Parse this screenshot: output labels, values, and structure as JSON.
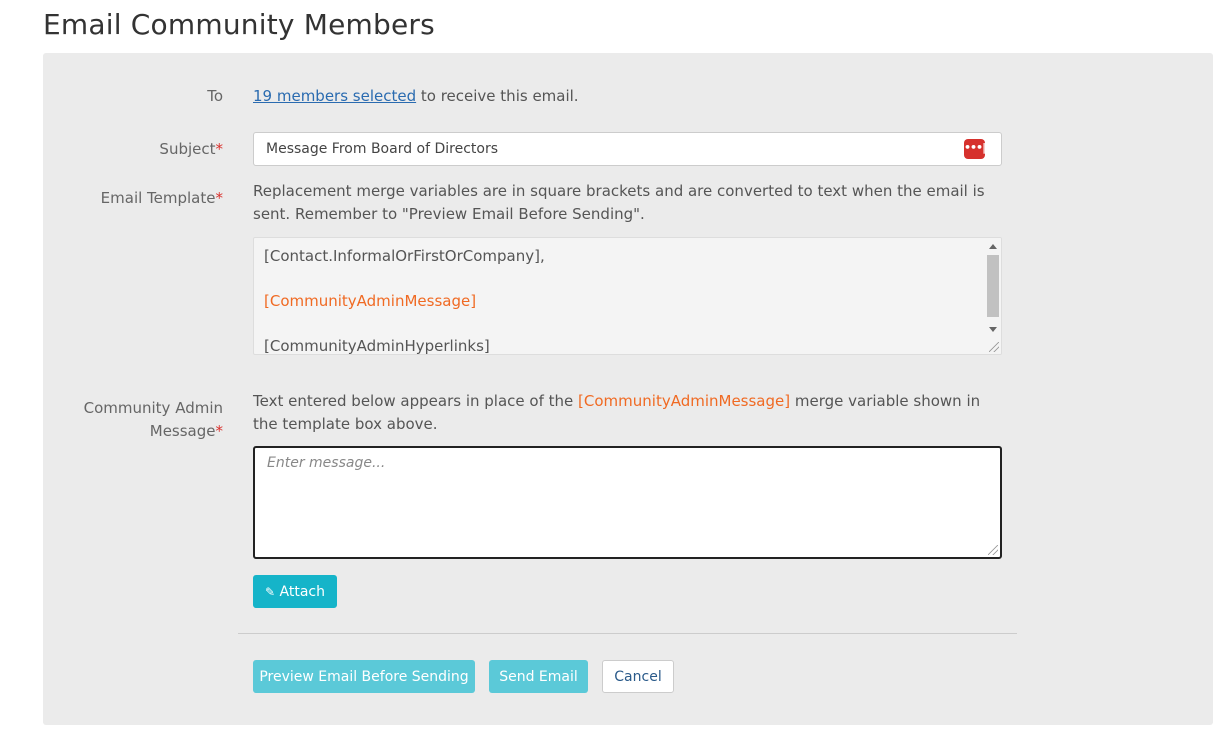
{
  "page": {
    "title": "Email Community Members"
  },
  "form": {
    "to": {
      "label": "To",
      "link_text": "19 members selected",
      "suffix": " to receive this email."
    },
    "subject": {
      "label": "Subject",
      "required_mark": "*",
      "value": "Message From Board of Directors",
      "icon": "password-manager-icon",
      "icon_glyph": "•••|"
    },
    "template": {
      "label": "Email Template",
      "required_mark": "*",
      "help": "Replacement merge variables are in square brackets and are converted to text when the email is sent. Remember to \"Preview Email Before Sending\".",
      "lines": [
        "[Contact.InformalOrFirstOrCompany],",
        "[CommunityAdminMessage]",
        "[CommunityAdminHyperlinks]"
      ]
    },
    "admin_message": {
      "label_line1": "Community Admin",
      "label_line2": "Message",
      "required_mark": "*",
      "help_before": "Text entered below appears in place of the ",
      "help_variable": "[CommunityAdminMessage]",
      "help_after": " merge variable shown in the template box above.",
      "placeholder": "Enter message..."
    },
    "attach": {
      "label": "Attach",
      "icon": "paperclip-icon",
      "icon_glyph": "✎"
    }
  },
  "actions": {
    "preview_label": "Preview Email Before Sending",
    "send_label": "Send Email",
    "cancel_label": "Cancel"
  },
  "colors": {
    "accent": "#15b4c9",
    "accent_light": "#5bc9d8",
    "merge_variable": "#f06a23",
    "required": "#d9302c",
    "link": "#2a6bb0"
  }
}
